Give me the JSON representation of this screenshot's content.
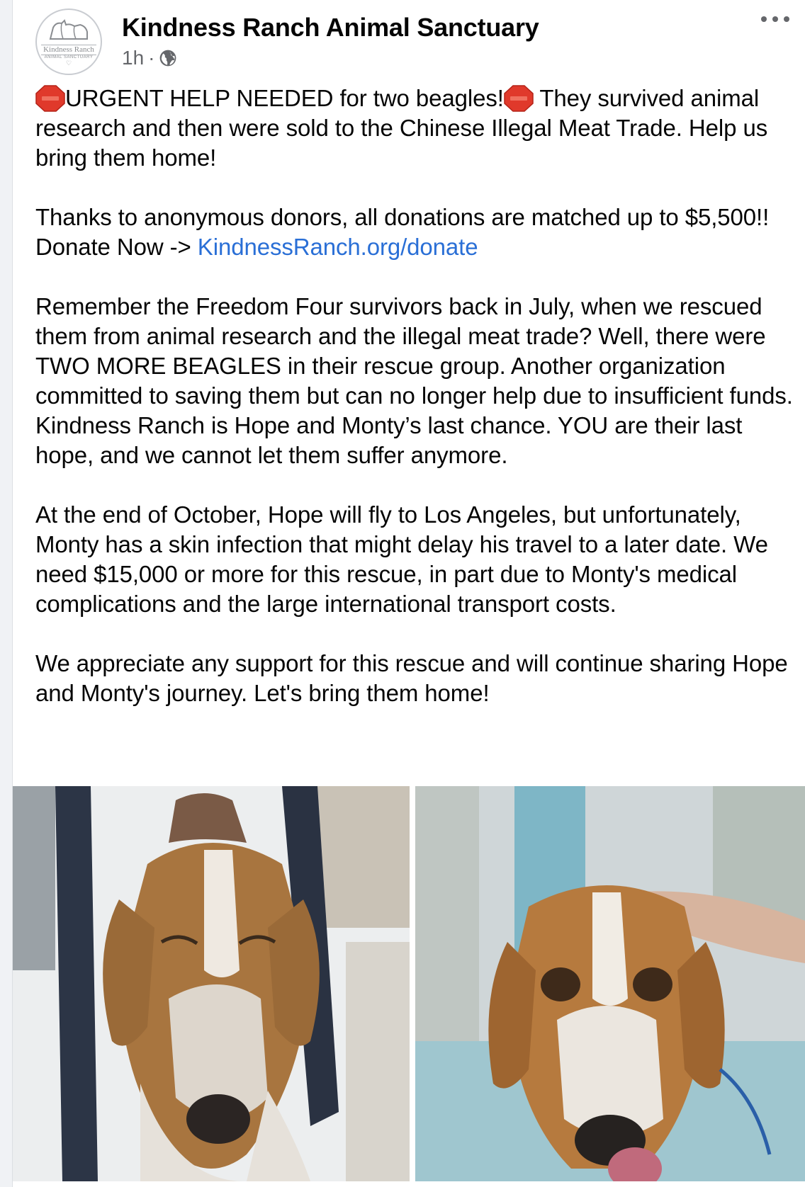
{
  "page": {
    "name": "Kindness Ranch Animal Sanctuary",
    "time": "1h",
    "separator": "·",
    "avatar": {
      "logo_text": "Kindness Ranch",
      "logo_sub": "ANIMAL SANCTUARY",
      "heart": "♡"
    }
  },
  "post": {
    "p1": {
      "text_a": "URGENT HELP NEEDED for two beagles!",
      "text_b": " They survived animal research and then were sold to the Chinese Illegal Meat Trade. Help us bring them home!"
    },
    "p2": {
      "text": "Thanks to anonymous donors, all donations are matched up to $5,500!! Donate Now -> ",
      "link": "KindnessRanch.org/donate"
    },
    "p3": "Remember the Freedom Four survivors back in July, when we rescued them from animal research and the illegal meat trade? Well, there were TWO MORE BEAGLES in their rescue group. Another organization committed to saving them but can no longer help due to insufficient funds. Kindness Ranch is Hope and Monty’s last chance. YOU are their last hope, and we cannot let them suffer anymore.",
    "p4": "At the end of October, Hope will fly to Los Angeles, but unfortunately, Monty has a skin infection that might delay his travel to a later date. We need $15,000 or more for this rescue, in part due to Monty's medical complications and the large international transport costs.",
    "p5": "We appreciate any support for this rescue and will continue sharing Hope and Monty's journey. Let's bring them home!"
  },
  "icons": {
    "stop": "stop-sign-emoji",
    "privacy": "globe-icon",
    "menu": "more-horizontal-icon"
  },
  "colors": {
    "link": "#2a6fd6",
    "meta": "#65676b",
    "stop_sign": "#e0392b"
  }
}
